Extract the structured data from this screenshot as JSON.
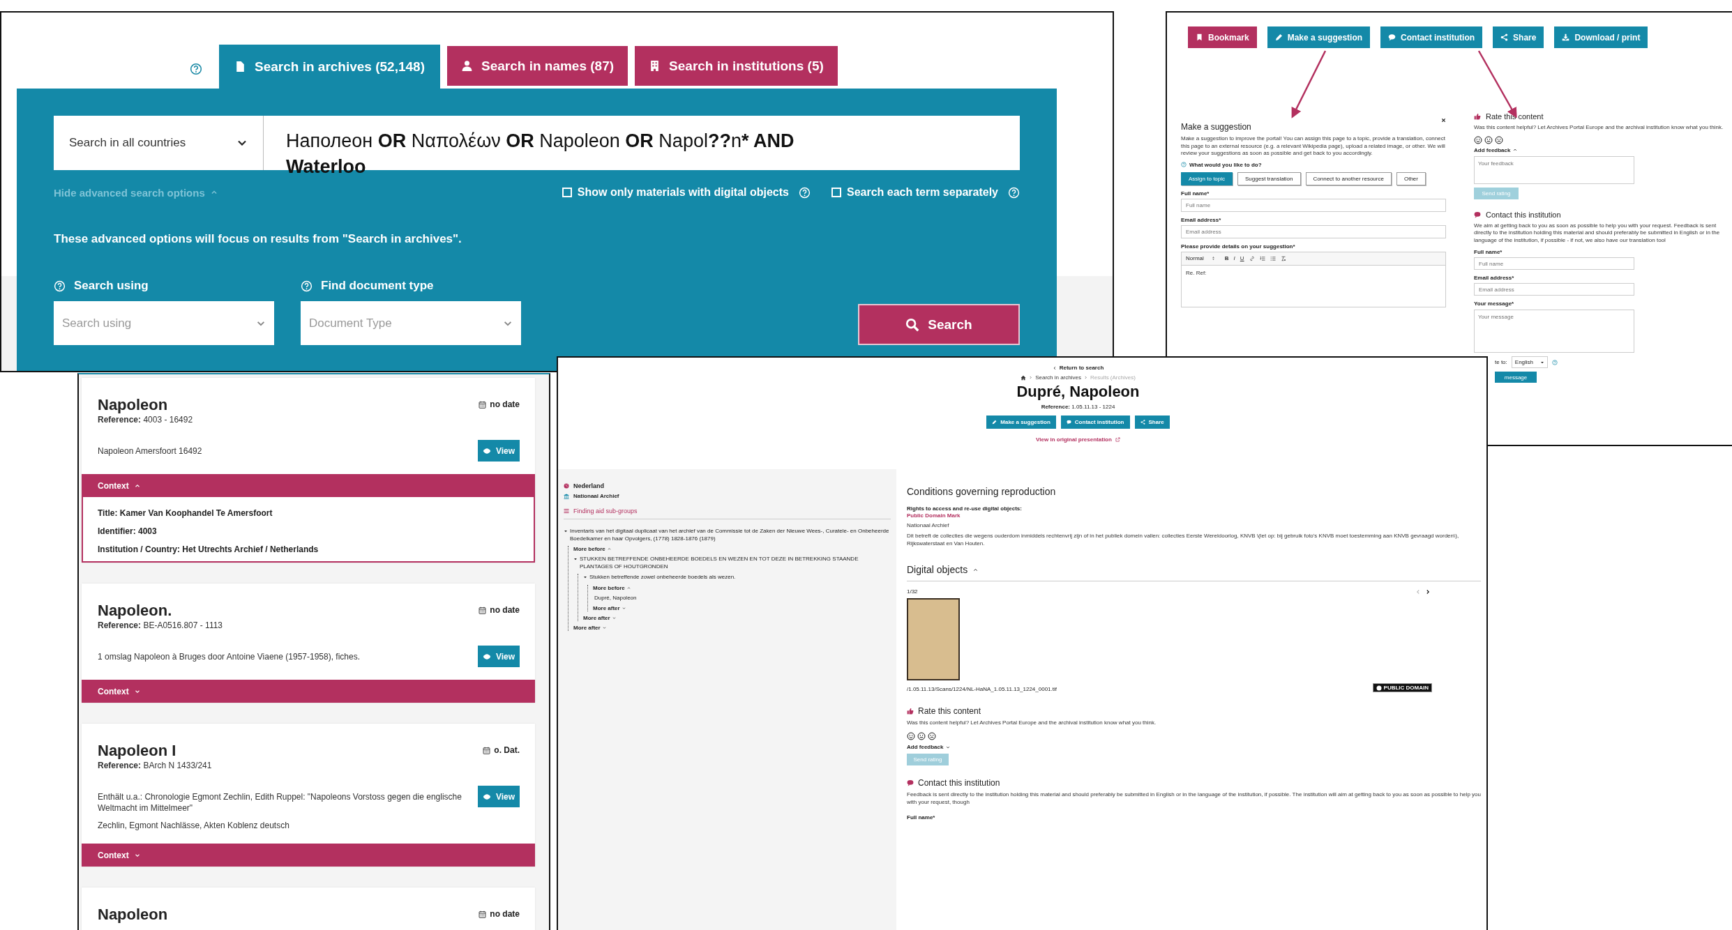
{
  "search_window": {
    "tabs": [
      {
        "label": "Search in archives (52,148)",
        "kind": "archives",
        "selected": true
      },
      {
        "label": "Search in names (87)",
        "kind": "names",
        "selected": false
      },
      {
        "label": "Search in institutions (5)",
        "kind": "institutions",
        "selected": false
      }
    ],
    "country_select": "Search in all countries",
    "query": [
      {
        "text": "Наполеон ",
        "bold": false
      },
      {
        "text": "OR",
        "bold": true
      },
      {
        "text": " Ναπολέων ",
        "bold": false
      },
      {
        "text": "OR",
        "bold": true
      },
      {
        "text": " Napoleon ",
        "bold": false
      },
      {
        "text": "OR",
        "bold": true
      },
      {
        "text": " Napol",
        "bold": false
      },
      {
        "text": "??",
        "bold": true
      },
      {
        "text": "n",
        "bold": false
      },
      {
        "text": "* AND\nWaterloo",
        "bold": true
      }
    ],
    "advanced_toggle": {
      "label": "Hide advanced search options",
      "expanded": true
    },
    "checkboxes": [
      {
        "label": "Show only materials with digital objects",
        "checked": false
      },
      {
        "label": "Search each term separately",
        "checked": false
      }
    ],
    "notice": "These advanced options will focus on results from \"Search in archives\".",
    "filters": [
      {
        "label": "Search using",
        "placeholder": "Search using"
      },
      {
        "label": "Find document type",
        "placeholder": "Document Type"
      }
    ],
    "search_button": "Search"
  },
  "actions_window": {
    "buttons": [
      {
        "label": "Bookmark",
        "kind": "bookmark"
      },
      {
        "label": "Make a suggestion",
        "kind": "suggest"
      },
      {
        "label": "Contact institution",
        "kind": "contact"
      },
      {
        "label": "Share",
        "kind": "share"
      },
      {
        "label": "Download / print",
        "kind": "download"
      }
    ],
    "suggestion_form": {
      "title": "Make a suggestion",
      "intro": "Make a suggestion to improve the portal! You can assign this page to a topic, provide a translation, connect this page to an external resource (e.g. a relevant Wikipedia page), upload a related image, or other. We will review your suggestions as soon as possible and get back to you accordingly.",
      "question": "What would you like to do?",
      "options": [
        {
          "label": "Assign to topic",
          "selected": true
        },
        {
          "label": "Suggest translation",
          "selected": false
        },
        {
          "label": "Connect to another resource",
          "selected": false
        },
        {
          "label": "Other",
          "selected": false
        }
      ],
      "fields": [
        {
          "label": "Full name*",
          "placeholder": "Full name"
        },
        {
          "label": "Email address*",
          "placeholder": "Email address"
        }
      ],
      "details_label": "Please provide details on your suggestion*",
      "editor_format": "Normal",
      "editor_toolbar": [
        {
          "kind": "bold",
          "label": "B"
        },
        {
          "kind": "italic",
          "label": "I"
        },
        {
          "kind": "underline",
          "label": "U"
        },
        {
          "kind": "link"
        },
        {
          "kind": "ordered-list"
        },
        {
          "kind": "bullet-list"
        },
        {
          "kind": "clear-format"
        }
      ],
      "editor_text": "Re. Ref:"
    },
    "rating": {
      "title": "Rate this content",
      "text": "Was this content helpful? Let Archives Portal Europe and the archival institution know what you think.",
      "feedback_toggle": "Add feedback",
      "feedback_expanded": true,
      "feedback_placeholder": "Your feedback",
      "send_button": "Send rating",
      "send_disabled": true
    },
    "contact": {
      "title": "Contact this institution",
      "text": "We aim at getting back to you as soon as possible to help you with your request. Feedback is sent directly to the institution holding this material and should preferably be submitted in English or in the language of the institution, if possible - if not, we also have our translation tool",
      "fields": [
        {
          "label": "Full name*",
          "placeholder": "Full name",
          "kind": "input"
        },
        {
          "label": "Email address*",
          "placeholder": "Email address",
          "kind": "input"
        },
        {
          "label": "Your message*",
          "placeholder": "Your message",
          "kind": "textarea"
        }
      ],
      "translate_label": "te to:",
      "language": "English",
      "send_button": "message"
    }
  },
  "results_window": {
    "results": [
      {
        "title": "Napoleon",
        "reference_label": "Reference:",
        "reference": "4003 - 16492",
        "date": "no date",
        "descriptions": [
          "Napoleon Amersfoort 16492"
        ],
        "view_button": "View",
        "context_label": "Context",
        "context_expanded": true,
        "context": [
          {
            "label": "Title:",
            "value": "Kamer Van Koophandel Te Amersfoort"
          },
          {
            "label": "Identifier:",
            "value": "4003"
          },
          {
            "label": "Institution / Country:",
            "value": "Het Utrechts Archief / Netherlands"
          }
        ]
      },
      {
        "title": "Napoleon.",
        "reference_label": "Reference:",
        "reference": "BE-A0516.807 - 1113",
        "date": "no date",
        "descriptions": [
          "1 omslag Napoleon à Bruges door Antoine Viaene (1957-1958), fiches."
        ],
        "view_button": "View",
        "context_label": "Context",
        "context_expanded": false
      },
      {
        "title": "Napoleon I",
        "reference_label": "Reference:",
        "reference": "BArch N 1433/241",
        "date": "o. Dat.",
        "descriptions": [
          "Enthält u.a.: Chronologie Egmont Zechlin, Edith Ruppel: \"Napoleons Vorstoss gegen die englische Weltmacht im Mittelmeer\"",
          "Zechlin, Egmont Nachlässe, Akten Koblenz deutsch"
        ],
        "view_button": "View",
        "context_label": "Context",
        "context_expanded": false
      },
      {
        "title": "Napoleon",
        "date": "no date"
      }
    ]
  },
  "detail_window": {
    "return_link": "Return to search",
    "breadcrumb": [
      {
        "label": "Search in archives",
        "current": false
      },
      {
        "label": "Results (Archives)",
        "current": true
      }
    ],
    "title": "Dupré, Napoleon",
    "reference_label": "Reference:",
    "reference": "1.05.11.13 - 1224",
    "buttons": [
      {
        "label": "Make a suggestion",
        "kind": "suggest"
      },
      {
        "label": "Contact institution",
        "kind": "contact"
      },
      {
        "label": "Share",
        "kind": "share"
      }
    ],
    "original_link": "View in original presentation",
    "country": "Nederland",
    "institution": "Nationaal Archief",
    "subgroups_title": "Finding aid sub-groups",
    "tree": [
      {
        "kind": "folder",
        "label": "Inventaris van het digitaal duplicaat van het archief van de Commissie tot de Zaken der Nieuwe Wees-, Curatele- en Onbeheerde Boedelkamer en haar Opvolgers, (1778) 1828-1876 (1879)",
        "expanded": true,
        "children": [
          {
            "kind": "more_before",
            "label": "More before"
          },
          {
            "kind": "folder",
            "label": "STUKKEN BETREFFENDE ONBEHEERDE BOEDELS EN WEZEN EN TOT DEZE IN BETREKKING STAANDE PLANTAGES OF HOUTGRONDEN",
            "expanded": true,
            "children": [
              {
                "kind": "folder",
                "label": "Stukken betreffende zowel onbeheerde boedels als wezen.",
                "expanded": true,
                "children": [
                  {
                    "kind": "more_before",
                    "label": "More before"
                  },
                  {
                    "kind": "leaf",
                    "label": "Dupré, Napoleon"
                  },
                  {
                    "kind": "more_after",
                    "label": "More after"
                  }
                ]
              },
              {
                "kind": "more_after",
                "label": "More after"
              }
            ]
          },
          {
            "kind": "more_after",
            "label": "More after"
          }
        ]
      }
    ],
    "conditions": {
      "title": "Conditions governing reproduction",
      "rights_label": "Rights to access and re-use digital objects:",
      "license_link": "Public Domain Mark",
      "holder": "Nationaal Archief",
      "text": "Dit betreft de collecties die wegens ouderdom inmiddels rechtenvrij zijn of in het publiek domein vallen: collecties Eerste Wereldoorlog, KNVB \\(let op: bij gebruik foto's KNVB moet toestemming aan KNVB gevraagd worden\\), Rijkswaterstaat en Van Houten."
    },
    "digital_objects": {
      "title": "Digital objects",
      "expanded": true,
      "counter": "1/32",
      "prev_disabled": true,
      "next_disabled": false,
      "filename": "/1.05.11.13/Scans/1224/NL-HaNA_1.05.11.13_1224_0001.tif",
      "badge": "PUBLIC DOMAIN"
    },
    "rating": {
      "title": "Rate this content",
      "text": "Was this content helpful? Let Archives Portal Europe and the archival institution know what you think.",
      "feedback_toggle": "Add feedback",
      "feedback_expanded": false,
      "send_button": "Send rating",
      "send_disabled": true
    },
    "contact": {
      "title": "Contact this institution",
      "text": "Feedback is sent directly to the institution holding this material and should preferably be submitted in English or in the language of the institution, if possible. The institution will aim at getting back to you as soon as possible to help you with your request, though",
      "field_label": "Full name*"
    }
  }
}
